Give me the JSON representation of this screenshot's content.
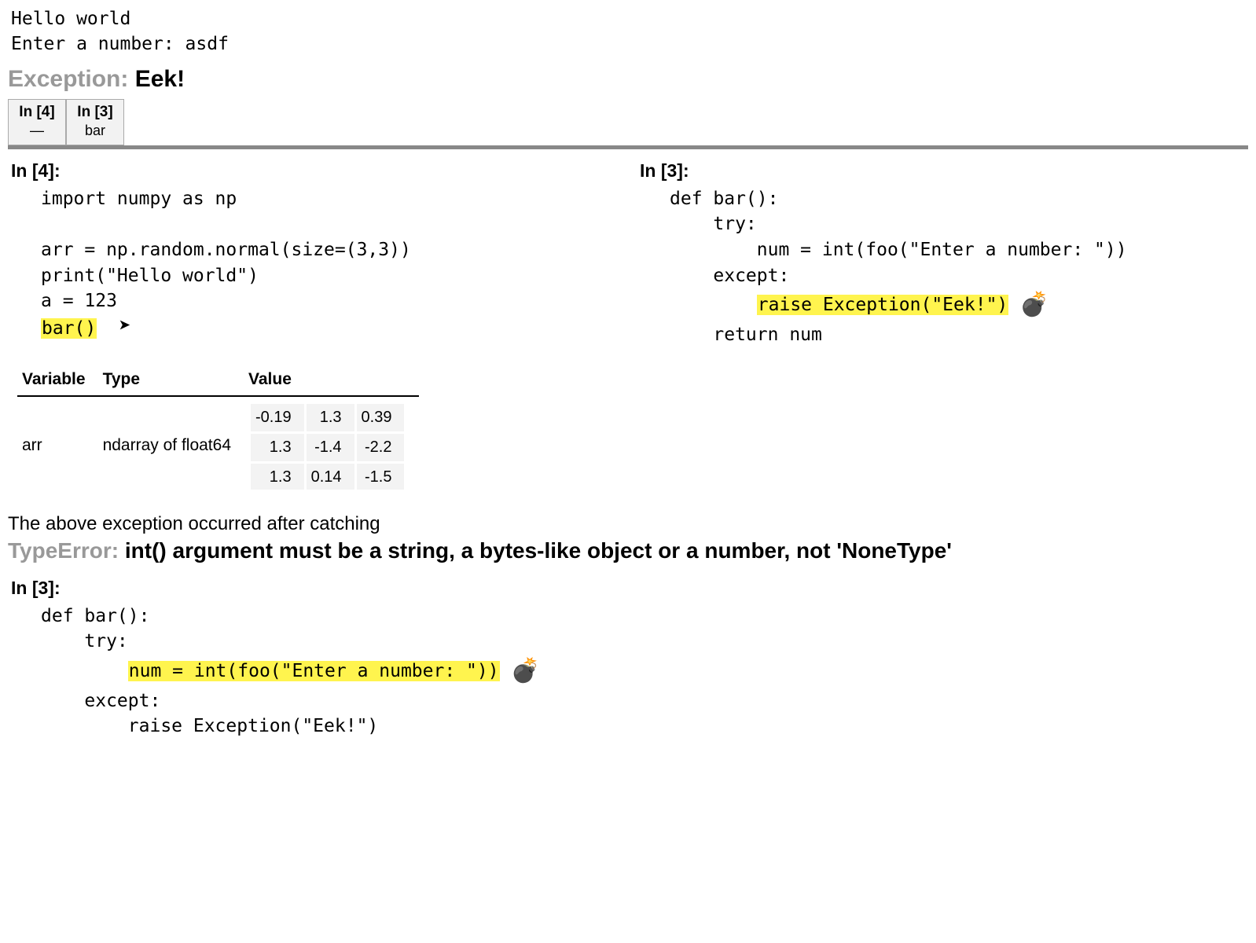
{
  "output": {
    "line1": "Hello world",
    "line2": "Enter a number: asdf"
  },
  "exception1": {
    "type": "Exception:",
    "message": "Eek!"
  },
  "tabs": [
    {
      "prompt": "In [4]",
      "sub": "—"
    },
    {
      "prompt": "In [3]",
      "sub": "bar"
    }
  ],
  "left": {
    "prompt": "In [4]:",
    "lines": {
      "l1": "import numpy as np",
      "blank": " ",
      "l2": "arr = np.random.normal(size=(3,3))",
      "l3": "print(\"Hello world\")",
      "l4": "a = 123",
      "l5": "bar()"
    }
  },
  "right": {
    "prompt": "In [3]:",
    "lines": {
      "l1": "def bar():",
      "l2": "    try:",
      "l3": "        num = int(foo(\"Enter a number: \"))",
      "l4": "    except:",
      "l5": "raise Exception(\"Eek!\")",
      "l5_indent": "        ",
      "l6": "    return num"
    }
  },
  "vartable": {
    "headers": {
      "variable": "Variable",
      "type": "Type",
      "value": "Value"
    },
    "row": {
      "name": "arr",
      "type": "ndarray of float64"
    },
    "matrix": [
      [
        "-0.19",
        "1.3",
        "0.39"
      ],
      [
        "1.3",
        "-1.4",
        "-2.2"
      ],
      [
        "1.3",
        "0.14",
        "-1.5"
      ]
    ]
  },
  "chained_text": "The above exception occurred after catching",
  "exception2": {
    "type": "TypeError:",
    "message": "int() argument must be a string, a bytes-like object or a number, not 'NoneType'"
  },
  "lower": {
    "prompt": "In [3]:",
    "lines": {
      "l1": "def bar():",
      "l2": "    try:",
      "l3": "num = int(foo(\"Enter a number: \"))",
      "l3_indent": "        ",
      "l4": "    except:",
      "l5": "        raise Exception(\"Eek!\")"
    }
  },
  "icons": {
    "arrow": "➤",
    "bomb": "💣"
  }
}
